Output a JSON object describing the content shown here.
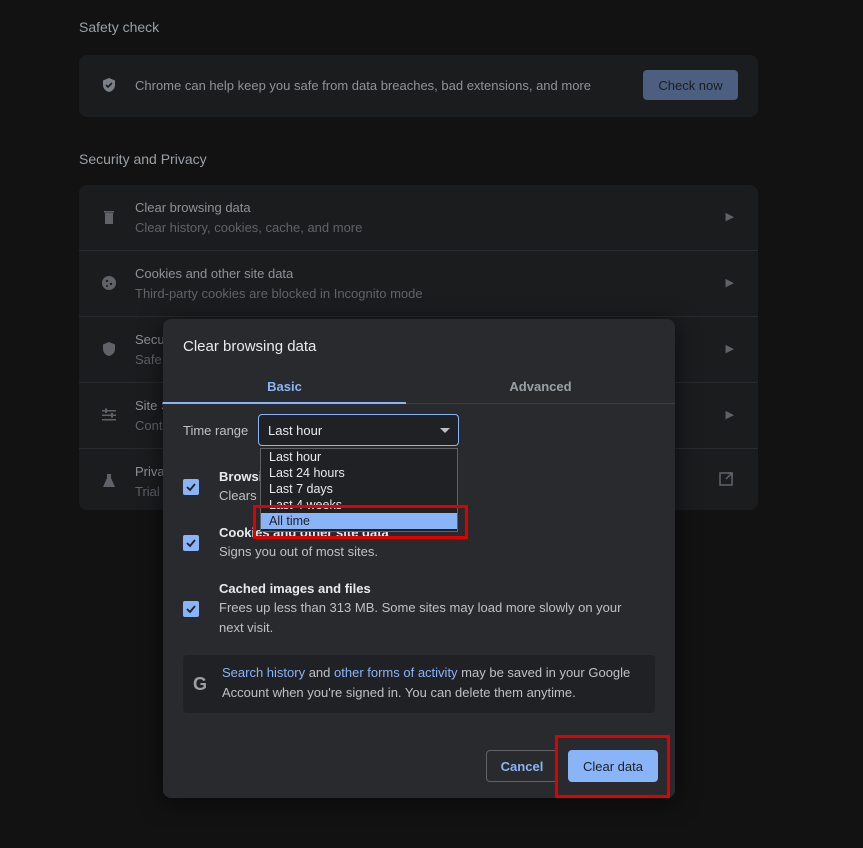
{
  "safety": {
    "section_title": "Safety check",
    "text": "Chrome can help keep you safe from data breaches, bad extensions, and more",
    "button": "Check now",
    "icon": "shield-check-icon"
  },
  "security": {
    "section_title": "Security and Privacy",
    "rows": [
      {
        "title": "Clear browsing data",
        "sub": "Clear history, cookies, cache, and more",
        "icon": "trash-icon"
      },
      {
        "title": "Cookies and other site data",
        "sub": "Third-party cookies are blocked in Incognito mode",
        "icon": "cookie-icon"
      },
      {
        "title": "Secu",
        "sub": "Safe",
        "icon": "shield-icon"
      },
      {
        "title": "Site S",
        "sub": "Cont",
        "icon": "sliders-icon"
      },
      {
        "title": "Priva",
        "sub": "Trial",
        "icon": "flask-icon"
      }
    ]
  },
  "dialog": {
    "title": "Clear browsing data",
    "tabs": [
      "Basic",
      "Advanced"
    ],
    "time_range_label": "Time range",
    "time_range_value": "Last hour",
    "options": [
      "Last hour",
      "Last 24 hours",
      "Last 7 days",
      "Last 4 weeks",
      "All time"
    ],
    "items": [
      {
        "title": "Browsi",
        "sub": "Clears l",
        "checked": true
      },
      {
        "title": "Cookies and other site data",
        "sub": "Signs you out of most sites.",
        "checked": true
      },
      {
        "title": "Cached images and files",
        "sub": "Frees up less than 313 MB. Some sites may load more slowly on your next visit.",
        "checked": true
      }
    ],
    "info": {
      "link1": "Search history",
      "mid": " and ",
      "link2": "other forms of activity",
      "rest": " may be saved in your Google Account when you're signed in. You can delete them anytime.",
      "icon_letter": "G"
    },
    "cancel": "Cancel",
    "clear": "Clear data"
  },
  "colors": {
    "accent": "#8ab4f8",
    "highlight": "#e00000"
  }
}
